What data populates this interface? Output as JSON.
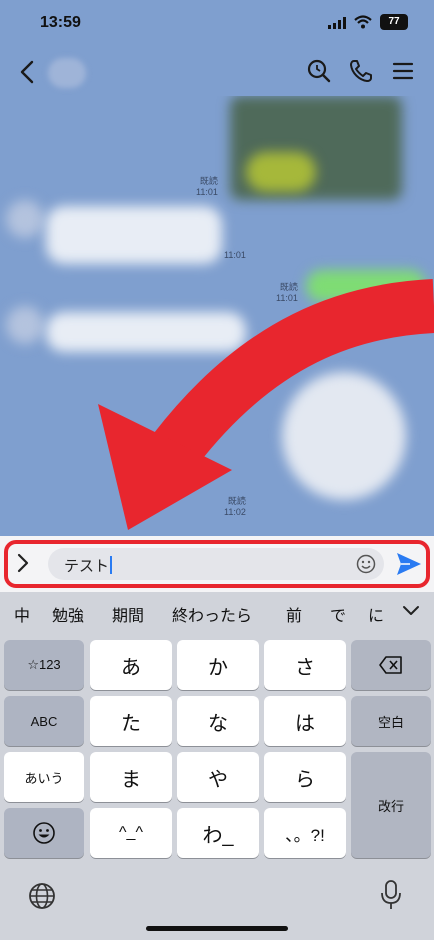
{
  "status_bar": {
    "time": "13:59",
    "battery": "77"
  },
  "chat": {
    "messages": [
      {
        "read": "既読",
        "time": "11:01"
      },
      {
        "time": "11:01"
      },
      {
        "read": "既読",
        "time": "11:01"
      },
      {
        "read": "既読",
        "time": "11:02"
      }
    ]
  },
  "composer": {
    "text": "テスト"
  },
  "keyboard": {
    "suggestions": [
      "中",
      "勉強",
      "期間",
      "終わったら",
      "前",
      "で",
      "に"
    ],
    "keys": {
      "symbols": "☆123",
      "abc": "ABC",
      "aiueo": "あいう",
      "a": "あ",
      "ka": "か",
      "sa": "さ",
      "ta": "た",
      "na": "な",
      "ha": "は",
      "ma": "ま",
      "ya": "や",
      "ra": "ら",
      "kaomoji": "^_^",
      "wa": "わ_",
      "punct": "、。?!",
      "space": "空白",
      "enter": "改行"
    }
  },
  "colors": {
    "chat_bg": "#7f9fcf",
    "send": "#2a7bf2",
    "highlight": "#e8262e",
    "bubble_green": "#7fdc74"
  },
  "icons": [
    "back-icon",
    "search-icon",
    "phone-icon",
    "menu-icon",
    "expand-icon",
    "emoji-icon",
    "send-icon",
    "backspace-icon",
    "emoji-key-icon",
    "globe-icon",
    "mic-icon",
    "chevron-down-icon"
  ]
}
